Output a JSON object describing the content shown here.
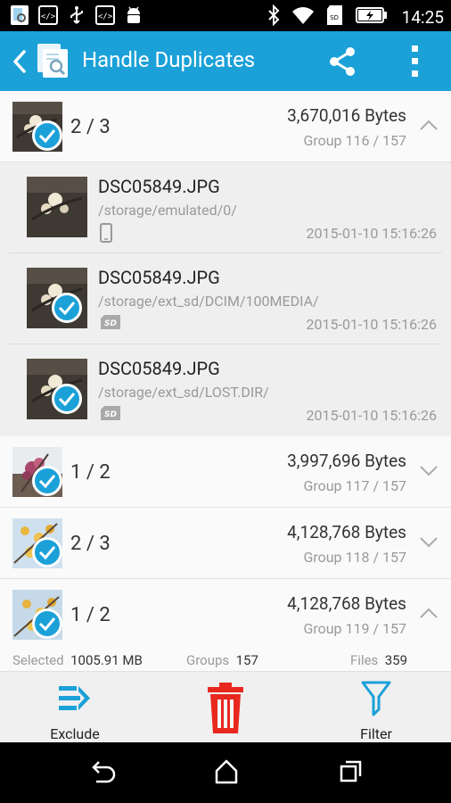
{
  "status_bar": {
    "time": "14:25",
    "left_icons": [
      "app-notification-icon",
      "code-icon",
      "usb-icon",
      "code-icon",
      "android-icon"
    ],
    "right_icons": [
      "bluetooth-icon",
      "wifi-icon",
      "sd-card-icon",
      "battery-charging-icon"
    ]
  },
  "appbar": {
    "title": "Handle Duplicates",
    "accent": "#1ba1d8"
  },
  "groups": [
    {
      "count": "2 / 3",
      "bytes": "3,670,016 Bytes",
      "group": "Group 116 / 157",
      "expanded": true
    },
    {
      "count": "1 / 2",
      "bytes": "3,997,696 Bytes",
      "group": "Group 117 / 157",
      "expanded": false
    },
    {
      "count": "2 / 3",
      "bytes": "4,128,768 Bytes",
      "group": "Group 118 / 157",
      "expanded": false
    },
    {
      "count": "1 / 2",
      "bytes": "4,128,768 Bytes",
      "group": "Group 119 / 157",
      "expanded": true
    }
  ],
  "files": [
    {
      "name": "DSC05849.JPG",
      "path": "/storage/emulated/0/",
      "date": "2015-01-10 15:16:26",
      "device": "phone-icon",
      "checked": false
    },
    {
      "name": "DSC05849.JPG",
      "path": "/storage/ext_sd/DCIM/100MEDIA/",
      "date": "2015-01-10 15:16:26",
      "device": "sd-card-icon",
      "checked": true
    },
    {
      "name": "DSC05849.JPG",
      "path": "/storage/ext_sd/LOST.DIR/",
      "date": "2015-01-10 15:16:26",
      "device": "sd-card-icon",
      "checked": true
    }
  ],
  "summary": {
    "selected_label": "Selected",
    "selected_value": "1005.91 MB",
    "groups_label": "Groups",
    "groups_value": "157",
    "files_label": "Files",
    "files_value": "359"
  },
  "actions": {
    "exclude": "Exclude",
    "delete_color": "#e8281e",
    "filter": "Filter"
  }
}
